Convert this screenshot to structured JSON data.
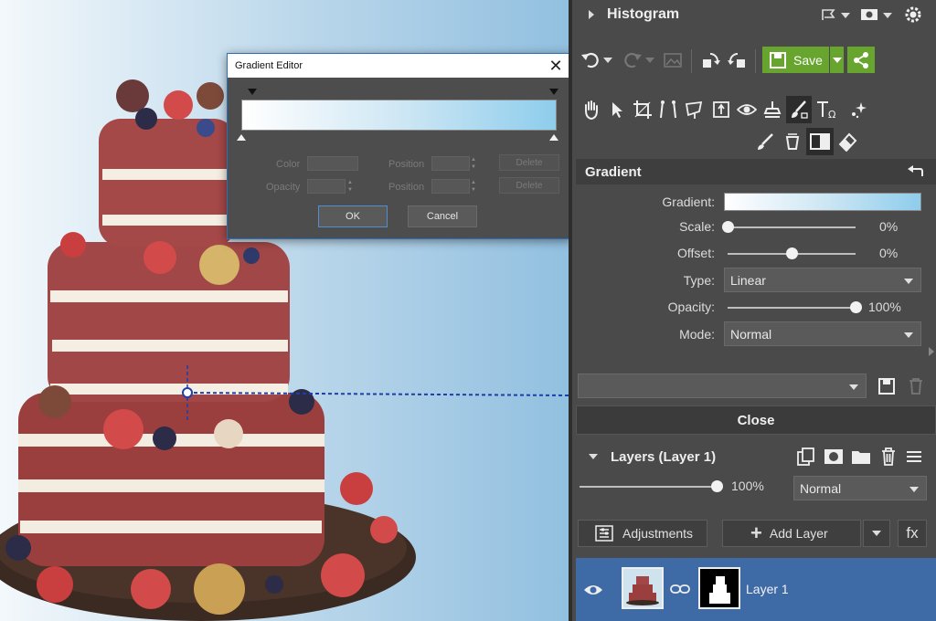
{
  "dialog": {
    "title": "Gradient Editor",
    "close_glyph": "✕",
    "color_label": "Color",
    "opacity_label": "Opacity",
    "position_label": "Position",
    "delete_label": "Delete",
    "ok_label": "OK",
    "cancel_label": "Cancel"
  },
  "panel": {
    "histogram_title": "Histogram",
    "save_label": "Save",
    "gradient_title": "Gradient",
    "props": {
      "gradient_label": "Gradient:",
      "scale_label": "Scale:",
      "scale_value": "0%",
      "scale_fraction": 0.0,
      "offset_label": "Offset:",
      "offset_value": "0%",
      "offset_fraction": 0.5,
      "type_label": "Type:",
      "type_value": "Linear",
      "opacity_label": "Opacity:",
      "opacity_value": "100%",
      "opacity_fraction": 1.0,
      "mode_label": "Mode:",
      "mode_value": "Normal"
    },
    "preset_value": "",
    "close_label": "Close",
    "layers_title": "Layers (Layer 1)",
    "layer_opacity_value": "100%",
    "layer_opacity_fraction": 1.0,
    "blend_mode_value": "Normal",
    "adjustments_label": "Adjustments",
    "add_layer_label": "Add Layer",
    "fx_label": "fx",
    "layer_name": "Layer 1"
  },
  "colors": {
    "accent_green": "#67a52f",
    "selection_blue": "#3e6aa6",
    "gradient_start": "#ffffff",
    "gradient_end": "#8ecdec"
  }
}
